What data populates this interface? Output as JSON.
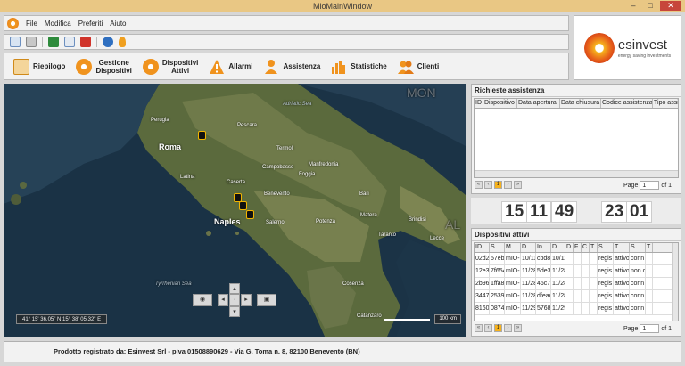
{
  "window": {
    "title": "MioMainWindow",
    "minimize": "–",
    "maximize": "□",
    "close": "✕"
  },
  "menu": {
    "items": [
      "File",
      "Modifica",
      "Preferiti",
      "Aiuto"
    ]
  },
  "toolbar": {
    "icons": [
      "search-icon",
      "tools-icon",
      "excel-icon",
      "print-preview-icon",
      "pdf-icon",
      "info-icon",
      "user-icon"
    ]
  },
  "nav": {
    "riepilogo": "Riepilogo",
    "gestione": [
      "Gestione",
      "Dispositivi"
    ],
    "dispositivi": [
      "Dispositivi",
      "Attivi"
    ],
    "allarmi": "Allarmi",
    "assistenza": "Assistenza",
    "statistiche": "Statistiche",
    "clienti": "Clienti"
  },
  "brand": {
    "name": "esinvest",
    "tagline": "energy saving investments"
  },
  "map": {
    "coords": "41° 15' 36,05\" N 15° 38' 05,32\" E",
    "scale": "100 km",
    "labels": {
      "roma": "Roma",
      "naples": "Naples",
      "bari": "Bari",
      "foggia": "Foggia",
      "pescara": "Pescara",
      "perugia": "Perugia",
      "salerno": "Salerno",
      "taranto": "Taranto",
      "potenza": "Potenza",
      "cosenza": "Cosenza",
      "catanzaro": "Catanzaro",
      "latina": "Latina",
      "caserta": "Caserta",
      "benevento": "Benevento",
      "campobasso": "Campobasso",
      "brindisi": "Brindisi",
      "lecce": "Lecce",
      "termoli": "Termoli",
      "manfredonia": "Manfredonia",
      "matera": "Matera",
      "adriatic": "Adriatic Sea",
      "tyrrhenian": "Tyrrhenian Sea",
      "mon": "MON",
      "al": "AL"
    }
  },
  "richieste": {
    "title": "Richieste assistenza",
    "columns": [
      "ID",
      "Dispositivo",
      "Data apertura",
      "Data chiusura",
      "Codice assistenza",
      "Tipo assist"
    ],
    "page_label": "Page",
    "page": "1",
    "of": "of 1",
    "current": "1"
  },
  "clock": {
    "h": "15",
    "m": "11",
    "s": "49",
    "d": "23",
    "mo": "01"
  },
  "dispositivi": {
    "title": "Dispositivi attivi",
    "columns": [
      "ID",
      "S",
      "M",
      "D",
      "In",
      "D",
      "D",
      "F",
      "C",
      "T",
      "S",
      "T",
      "S",
      "T"
    ],
    "rows": [
      [
        "02d2",
        "57eb",
        "mIO-",
        "10/11",
        "cbd8",
        "10/11",
        "",
        "",
        "",
        "",
        "regis",
        "attivo",
        "conn",
        ""
      ],
      [
        "12e3",
        "7f654",
        "mIO-",
        "11/28",
        "5de3",
        "11/28",
        "",
        "",
        "",
        "",
        "regis",
        "attivo",
        "non c",
        ""
      ],
      [
        "2b96",
        "1ffa8",
        "mIO-",
        "11/28",
        "46c7",
        "11/28",
        "",
        "",
        "",
        "",
        "regis",
        "attivo",
        "conn",
        ""
      ],
      [
        "3447",
        "2539",
        "mIO-",
        "11/28",
        "dfeac",
        "11/28",
        "",
        "",
        "",
        "",
        "regis",
        "attivo",
        "conn",
        ""
      ],
      [
        "8160",
        "0874",
        "mIO-",
        "11/29",
        "5768",
        "11/29",
        "",
        "",
        "",
        "",
        "regis",
        "attivo",
        "conn",
        ""
      ]
    ],
    "page_label": "Page",
    "page": "1",
    "of": "of 1",
    "current": "1"
  },
  "footer": {
    "text": "Prodotto registrato da: Esinvest Srl - pIva 01508890629 - Via G. Toma n. 8, 82100 Benevento (BN)"
  }
}
